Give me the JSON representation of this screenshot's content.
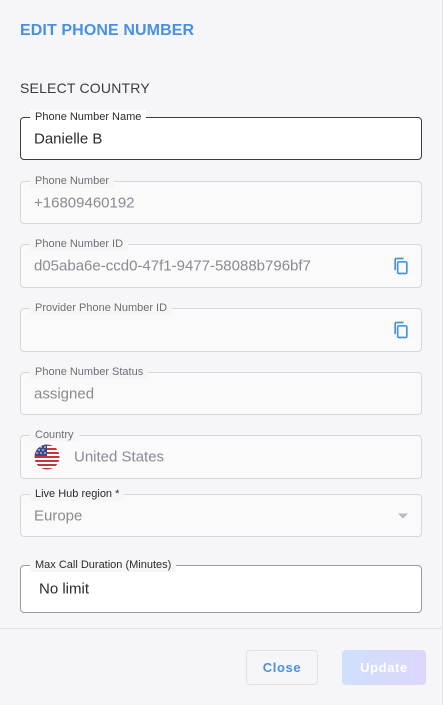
{
  "dialog": {
    "title": "EDIT PHONE NUMBER",
    "section_title": "SELECT COUNTRY"
  },
  "fields": {
    "phone_number_name": {
      "label": "Phone Number Name",
      "value": "Danielle B"
    },
    "phone_number": {
      "label": "Phone Number",
      "value": "+16809460192"
    },
    "phone_number_id": {
      "label": "Phone Number ID",
      "value": "d05aba6e-ccd0-47f1-9477-58088b796bf7"
    },
    "provider_phone_number_id": {
      "label": "Provider Phone Number ID",
      "value": ""
    },
    "phone_number_status": {
      "label": "Phone Number Status",
      "value": "assigned"
    },
    "country": {
      "label": "Country",
      "value": "United States",
      "flag_icon": "us-flag-icon"
    },
    "live_hub_region": {
      "label": "Live Hub region *",
      "value": "Europe"
    },
    "max_call_duration": {
      "label": "Max Call Duration (Minutes)",
      "value": "No limit"
    }
  },
  "buttons": {
    "close": "Close",
    "update": "Update"
  },
  "colors": {
    "accent": "#4a90e2",
    "background": "#f6f6f8",
    "update_gradient_start": "#cfe0fb",
    "update_gradient_end": "#dcd6fb"
  },
  "icons": {
    "copy": "copy-icon",
    "dropdown": "chevron-down-icon"
  }
}
